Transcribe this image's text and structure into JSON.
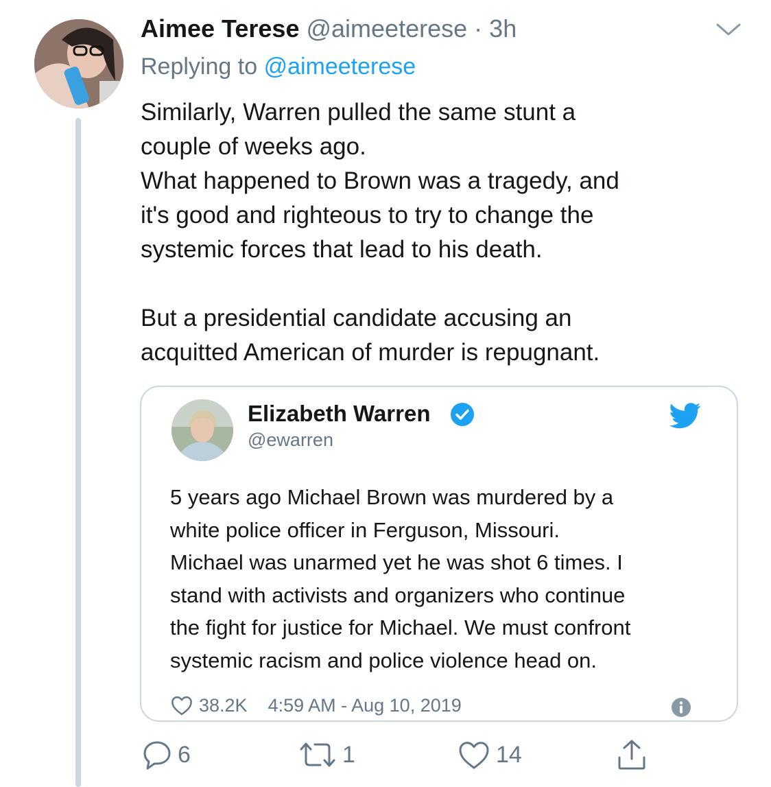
{
  "tweet": {
    "author_name": "Aimee Terese",
    "author_handle": "@aimeeterese",
    "separator": "·",
    "time": "3h",
    "replying_prefix": "Replying to",
    "replying_handle": "@aimeeterese",
    "text": "Similarly, Warren pulled the same stunt a\ncouple of weeks ago.\nWhat happened to Brown was a tragedy, and\nit's good and righteous to try to change the\nsystemic forces that lead to his death.\n\nBut a presidential candidate accusing an\nacquitted American of murder is repugnant."
  },
  "quoted": {
    "author_name": "Elizabeth Warren",
    "author_handle": "@ewarren",
    "text": "5 years ago Michael Brown was murdered by a\nwhite police officer in Ferguson, Missouri.\nMichael was unarmed yet he was shot 6 times. I\nstand with activists and organizers who continue\nthe fight for justice for Michael. We must confront\nsystemic racism and police violence head on.",
    "likes": "38.2K",
    "timestamp": "4:59 AM - Aug 10, 2019"
  },
  "actions": {
    "reply_count": "6",
    "retweet_count": "1",
    "like_count": "14"
  },
  "icons": {
    "chevron": "chevron-down-icon",
    "verified": "verified-badge-icon",
    "bird": "twitter-bird-icon",
    "info": "info-icon",
    "reply": "reply-icon",
    "retweet": "retweet-icon",
    "like": "heart-icon",
    "share": "share-icon"
  },
  "colors": {
    "text": "#14171a",
    "secondary": "#657786",
    "accent": "#1da1f2",
    "border": "#ccd6dd"
  }
}
